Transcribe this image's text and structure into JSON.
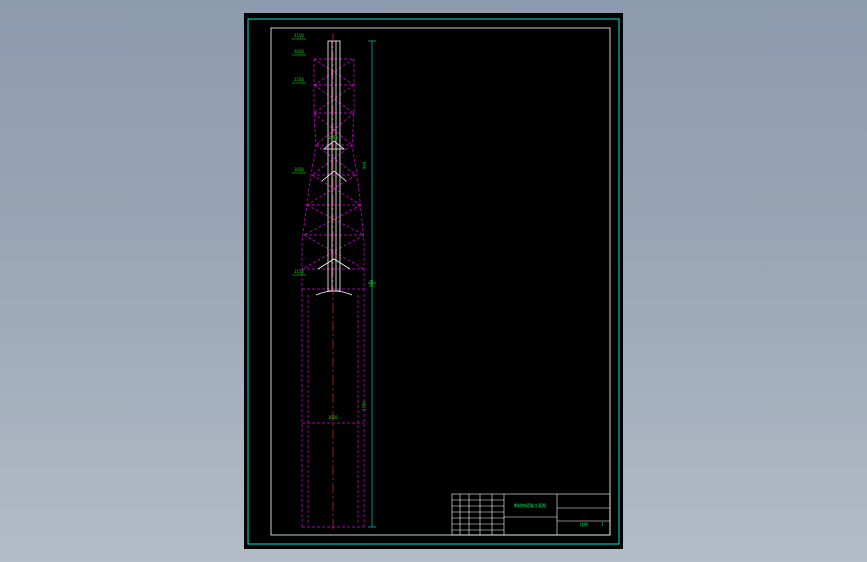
{
  "drawing": {
    "colors": {
      "background": "#000000",
      "frame": "#ffffff",
      "border_cyan": "#00e5e5",
      "structure": "#e000e0",
      "centerline": "#ff3030",
      "dimension": "#00e000",
      "titleblock": "#ffffff",
      "titleblock_text": "#00ff66"
    },
    "elevation_marks": [
      "3150",
      "2650",
      "2150",
      "1650",
      "1150",
      "600"
    ],
    "level_marks": [
      "2650",
      "1650"
    ],
    "dimensions": [
      "990",
      "500",
      "1750"
    ],
    "title_block": {
      "drawing_title": "钢结构塔架立面图",
      "scale_label": "比例",
      "sheet_label": "1",
      "sheet_count": "1"
    }
  }
}
